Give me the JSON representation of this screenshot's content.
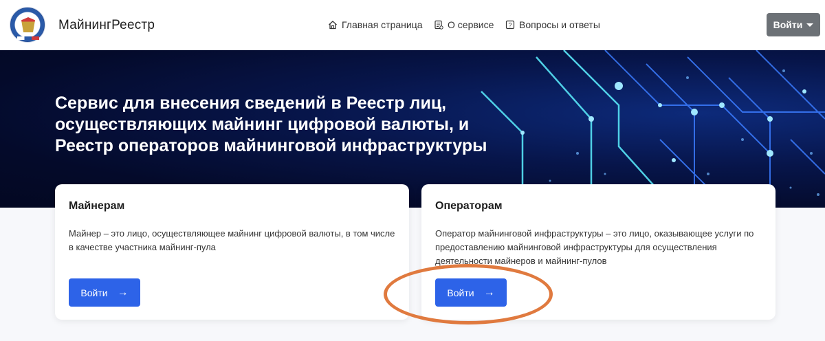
{
  "header": {
    "brand": "МайнингРеестр",
    "nav": {
      "home": "Главная страница",
      "about": "О сервисе",
      "faq": "Вопросы и ответы"
    },
    "login": "Войти"
  },
  "hero": {
    "title": "Сервис для внесения сведений в Реестр лиц, осуществляющих майнинг цифровой валюты, и Реестр операторов майнинговой инфраструктуры"
  },
  "cards": [
    {
      "title": "Майнерам",
      "text": "Майнер – это лицо, осуществляющее майнинг цифровой валюты, в том числе в качестве участника майнинг-пула",
      "button": "Войти"
    },
    {
      "title": "Операторам",
      "text": "Оператор майнинговой инфраструктуры – это лицо, оказывающее услуги по предоставлению майнинговой инфраструктуры для осуществления деятельности майнеров и майнинг-пулов",
      "button": "Войти"
    }
  ],
  "colors": {
    "accent": "#2d63e8",
    "login_bg": "#6c7176",
    "highlight": "#e07a3f"
  }
}
